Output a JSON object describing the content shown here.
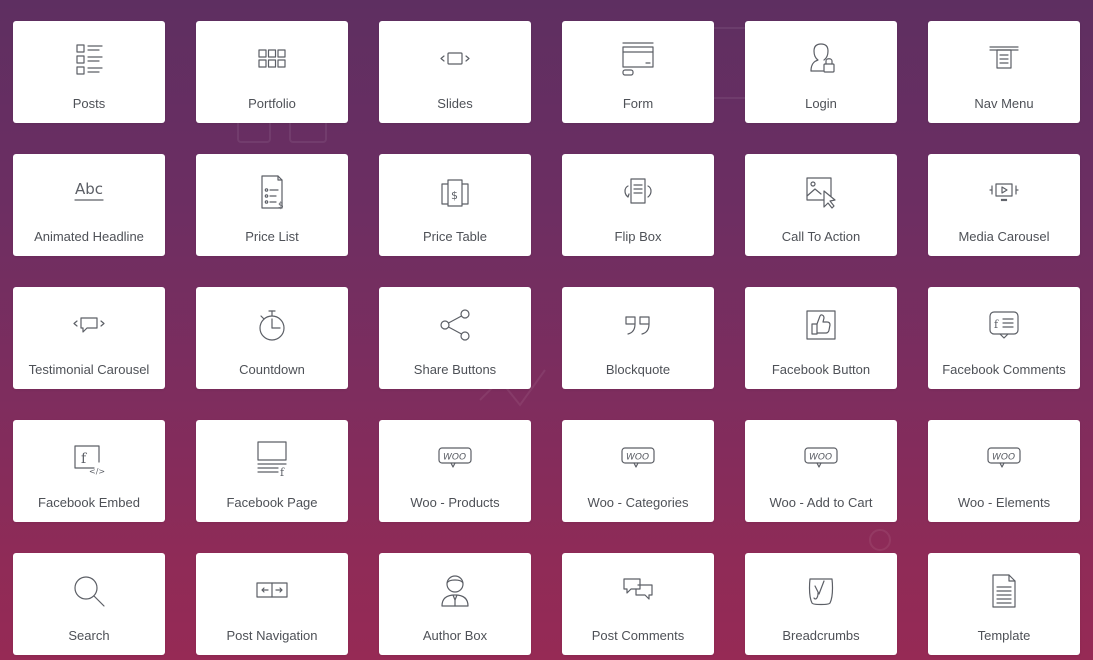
{
  "widgets": [
    {
      "label": "Posts",
      "icon": "posts-icon"
    },
    {
      "label": "Portfolio",
      "icon": "portfolio-icon"
    },
    {
      "label": "Slides",
      "icon": "slides-icon"
    },
    {
      "label": "Form",
      "icon": "form-icon"
    },
    {
      "label": "Login",
      "icon": "login-icon"
    },
    {
      "label": "Nav Menu",
      "icon": "nav-menu-icon"
    },
    {
      "label": "Animated Headline",
      "icon": "animated-headline-icon",
      "icon_text": "Abc"
    },
    {
      "label": "Price List",
      "icon": "price-list-icon"
    },
    {
      "label": "Price Table",
      "icon": "price-table-icon"
    },
    {
      "label": "Flip Box",
      "icon": "flip-box-icon"
    },
    {
      "label": "Call To Action",
      "icon": "call-to-action-icon"
    },
    {
      "label": "Media Carousel",
      "icon": "media-carousel-icon"
    },
    {
      "label": "Testimonial Carousel",
      "icon": "testimonial-carousel-icon"
    },
    {
      "label": "Countdown",
      "icon": "countdown-icon"
    },
    {
      "label": "Share Buttons",
      "icon": "share-buttons-icon"
    },
    {
      "label": "Blockquote",
      "icon": "blockquote-icon"
    },
    {
      "label": "Facebook Button",
      "icon": "facebook-button-icon"
    },
    {
      "label": "Facebook Comments",
      "icon": "facebook-comments-icon"
    },
    {
      "label": "Facebook Embed",
      "icon": "facebook-embed-icon"
    },
    {
      "label": "Facebook Page",
      "icon": "facebook-page-icon"
    },
    {
      "label": "Woo - Products",
      "icon": "woo-icon",
      "icon_text": "WOO"
    },
    {
      "label": "Woo - Categories",
      "icon": "woo-icon",
      "icon_text": "WOO"
    },
    {
      "label": "Woo - Add to Cart",
      "icon": "woo-icon",
      "icon_text": "WOO"
    },
    {
      "label": "Woo - Elements",
      "icon": "woo-icon",
      "icon_text": "WOO"
    },
    {
      "label": "Search",
      "icon": "search-icon"
    },
    {
      "label": "Post Navigation",
      "icon": "post-navigation-icon"
    },
    {
      "label": "Author Box",
      "icon": "author-box-icon"
    },
    {
      "label": "Post Comments",
      "icon": "post-comments-icon"
    },
    {
      "label": "Breadcrumbs",
      "icon": "breadcrumbs-icon"
    },
    {
      "label": "Template",
      "icon": "template-icon"
    }
  ]
}
